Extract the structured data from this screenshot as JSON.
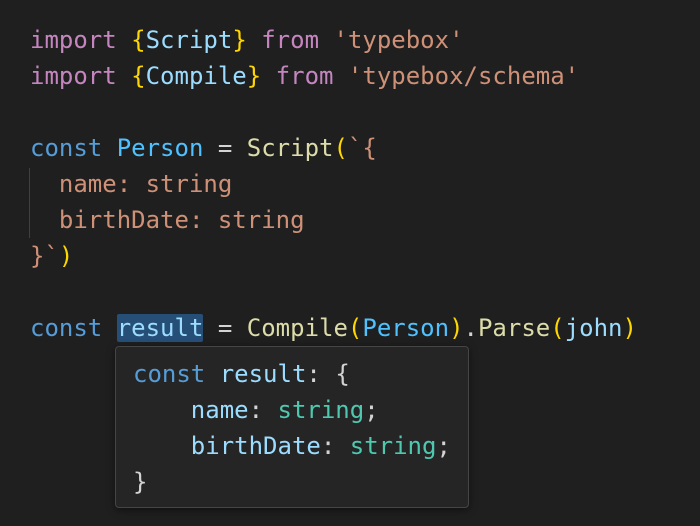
{
  "code": {
    "line1": {
      "kw": "import",
      "open": "{",
      "name": "Script",
      "close": "}",
      "from": "from",
      "module": "'typebox'"
    },
    "line2": {
      "kw": "import",
      "open": "{",
      "name": "Compile",
      "close": "}",
      "from": "from",
      "module": "'typebox/schema'"
    },
    "line4": {
      "kw": "const",
      "name": "Person",
      "eq": "=",
      "fn": "Script",
      "paren": "(",
      "tpl_open": "`{"
    },
    "line5": {
      "text": "name: string"
    },
    "line6": {
      "text": "birthDate: string"
    },
    "line7": {
      "tpl_close": "}`",
      "paren": ")"
    },
    "line9": {
      "kw": "const",
      "name": "result",
      "eq": "=",
      "fn": "Compile",
      "paren_open": "(",
      "arg": "Person",
      "paren_close": ")",
      "dot": ".",
      "method": "Parse",
      "paren2_open": "(",
      "arg2": "john",
      "paren2_close": ")"
    }
  },
  "hover": {
    "decl_kw": "const",
    "decl_name": "result",
    "colon": ":",
    "open": "{",
    "fields": [
      {
        "name": "name",
        "colon": ":",
        "type": "string",
        "semi": ";"
      },
      {
        "name": "birthDate",
        "colon": ":",
        "type": "string",
        "semi": ";"
      }
    ],
    "close": "}"
  },
  "colors": {
    "background": "#1f1f1f",
    "keyword_import": "#c586c0",
    "keyword_decl": "#569cd6",
    "bracket": "#ffd700",
    "variable": "#9cdcfe",
    "constant": "#4fc1ff",
    "function": "#dcdcaa",
    "string": "#ce9178",
    "type": "#4ec9b0",
    "selection": "#264f78"
  }
}
